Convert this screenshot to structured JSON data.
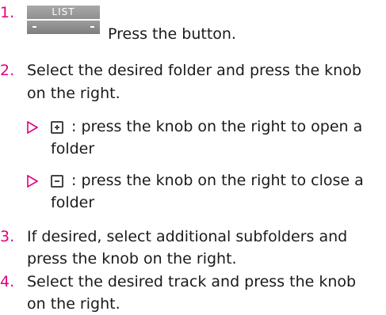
{
  "colors": {
    "accent": "#e4007c",
    "text": "#1a1a1a",
    "button_gray": "#999999"
  },
  "steps": [
    {
      "number": "1.",
      "button_label": "LIST",
      "lines": [
        "Press the button."
      ]
    },
    {
      "number": "2.",
      "lines": [
        "Select the desired folder and press the knob",
        "on the right."
      ],
      "bullets": [
        {
          "icon": "plus-box-icon",
          "lines": [
            ": press the knob on the right to open a",
            "folder"
          ]
        },
        {
          "icon": "minus-box-icon",
          "lines": [
            ": press the knob on the right to close a",
            "folder"
          ]
        }
      ]
    },
    {
      "number": "3.",
      "lines": [
        "If desired, select additional subfolders and",
        "press the knob on the right."
      ]
    },
    {
      "number": "4.",
      "lines": [
        "Select the desired track and press the knob",
        "on the right."
      ]
    }
  ]
}
